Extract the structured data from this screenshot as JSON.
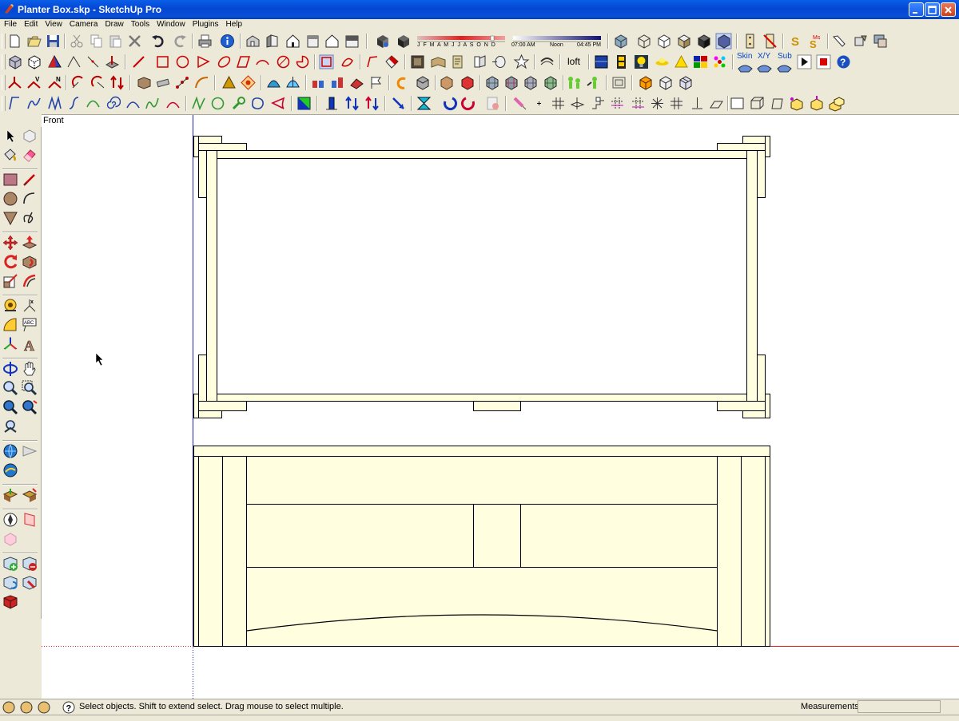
{
  "window": {
    "title": "Planter Box.skp - SketchUp Pro"
  },
  "menu": [
    "File",
    "Edit",
    "View",
    "Camera",
    "Draw",
    "Tools",
    "Window",
    "Plugins",
    "Help"
  ],
  "shadow": {
    "months": "J F M A M J J A S O N D",
    "time_start": "07:00 AM",
    "time_mid": "Noon",
    "time_end": "04:45 PM"
  },
  "toolbar_text": {
    "loft": "loft",
    "skin": "Skin",
    "xy": "X/Y",
    "sub": "Sub"
  },
  "viewport": {
    "view_name": "Front"
  },
  "status": {
    "message": "Select objects. Shift to extend select. Drag mouse to select multiple.",
    "measurements_label": "Measurements",
    "measurements_value": ""
  },
  "colors": {
    "wood": "#ffffe0",
    "axis_blue": "#2222cc",
    "axis_red": "#dd2222",
    "title_blue": "#0a5ee8"
  }
}
